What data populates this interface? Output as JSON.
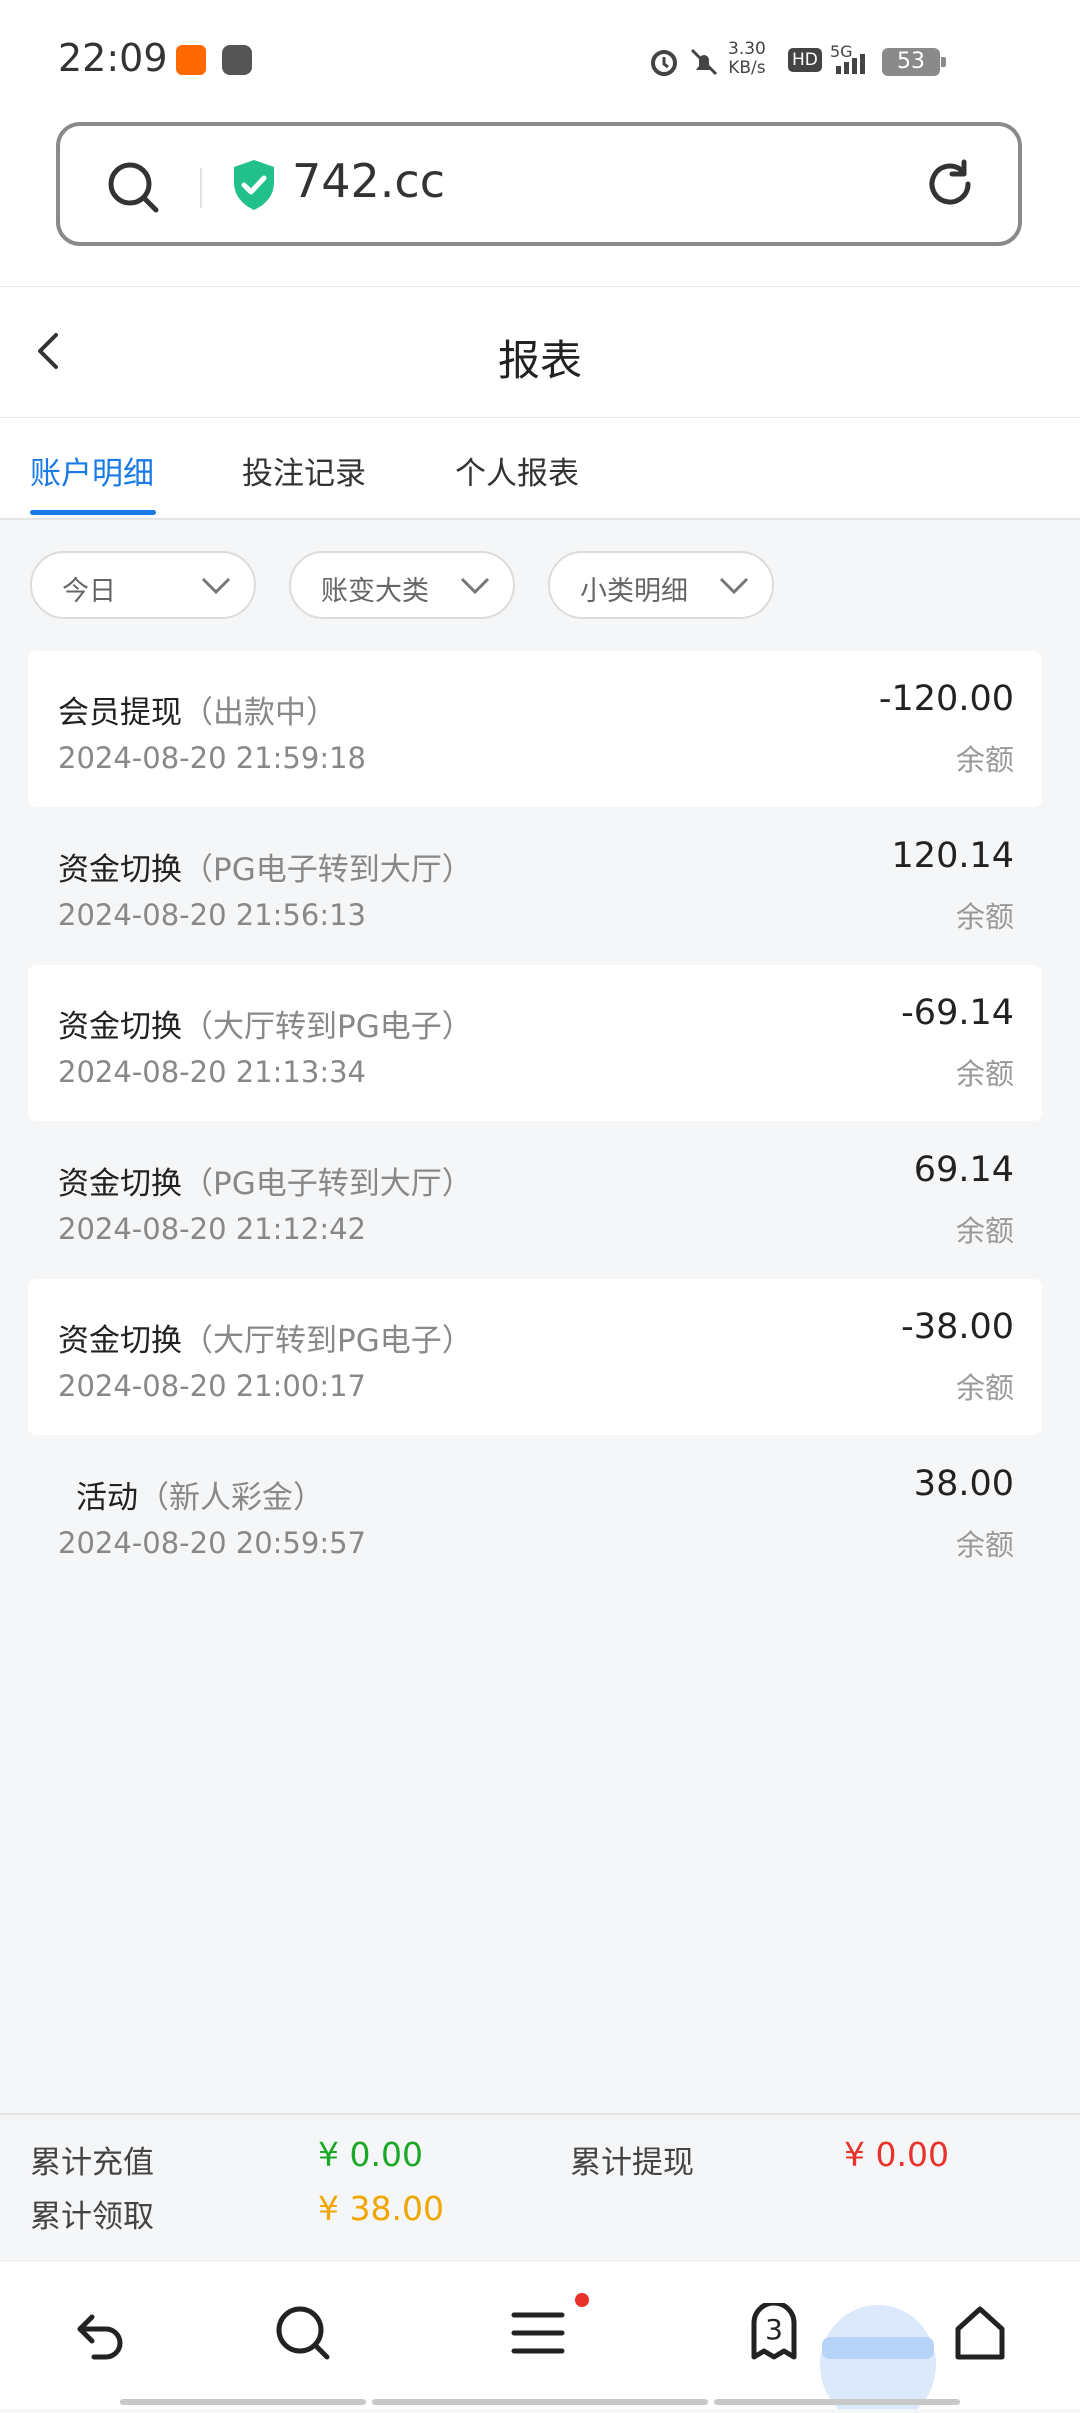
{
  "status_bar": {
    "time": "22:09",
    "net_speed_value": "3.30",
    "net_speed_unit": "KB/s",
    "hd": "HD",
    "signal": "5G",
    "battery": "53"
  },
  "address_bar": {
    "url": "742.cc"
  },
  "header": {
    "title": "报表"
  },
  "tabs": [
    {
      "label": "账户明细",
      "active": true
    },
    {
      "label": "投注记录",
      "active": false
    },
    {
      "label": "个人报表",
      "active": false
    }
  ],
  "filters": [
    {
      "label": "今日"
    },
    {
      "label": "账变大类"
    },
    {
      "label": "小类明细"
    }
  ],
  "records": [
    {
      "type": "会员提现",
      "detail": "（出款中）",
      "time": "2024-08-20 21:59:18",
      "amount": "-120.00",
      "label": "余额"
    },
    {
      "type": "资金切换",
      "detail": "（PG电子转到大厅）",
      "time": "2024-08-20 21:56:13",
      "amount": "120.14",
      "label": "余额"
    },
    {
      "type": "资金切换",
      "detail": "（大厅转到PG电子）",
      "time": "2024-08-20 21:13:34",
      "amount": "-69.14",
      "label": "余额"
    },
    {
      "type": "资金切换",
      "detail": "（PG电子转到大厅）",
      "time": "2024-08-20 21:12:42",
      "amount": "69.14",
      "label": "余额"
    },
    {
      "type": "资金切换",
      "detail": "（大厅转到PG电子）",
      "time": "2024-08-20 21:00:17",
      "amount": "-38.00",
      "label": "余额"
    },
    {
      "type": "活动",
      "detail": "（新人彩金）",
      "time": "2024-08-20 20:59:57",
      "amount": "38.00",
      "label": "余额"
    }
  ],
  "summary": {
    "recharge_label": "累计充值",
    "recharge_value": "¥ 0.00",
    "withdraw_label": "累计提现",
    "withdraw_value": "¥ 0.00",
    "claimed_label": "累计领取",
    "claimed_value": "¥ 38.00",
    "colors": {
      "recharge": "#1aa826",
      "withdraw": "#e8322b",
      "claimed": "#f0a500"
    }
  },
  "browser_nav": {
    "tab_count": "3"
  }
}
